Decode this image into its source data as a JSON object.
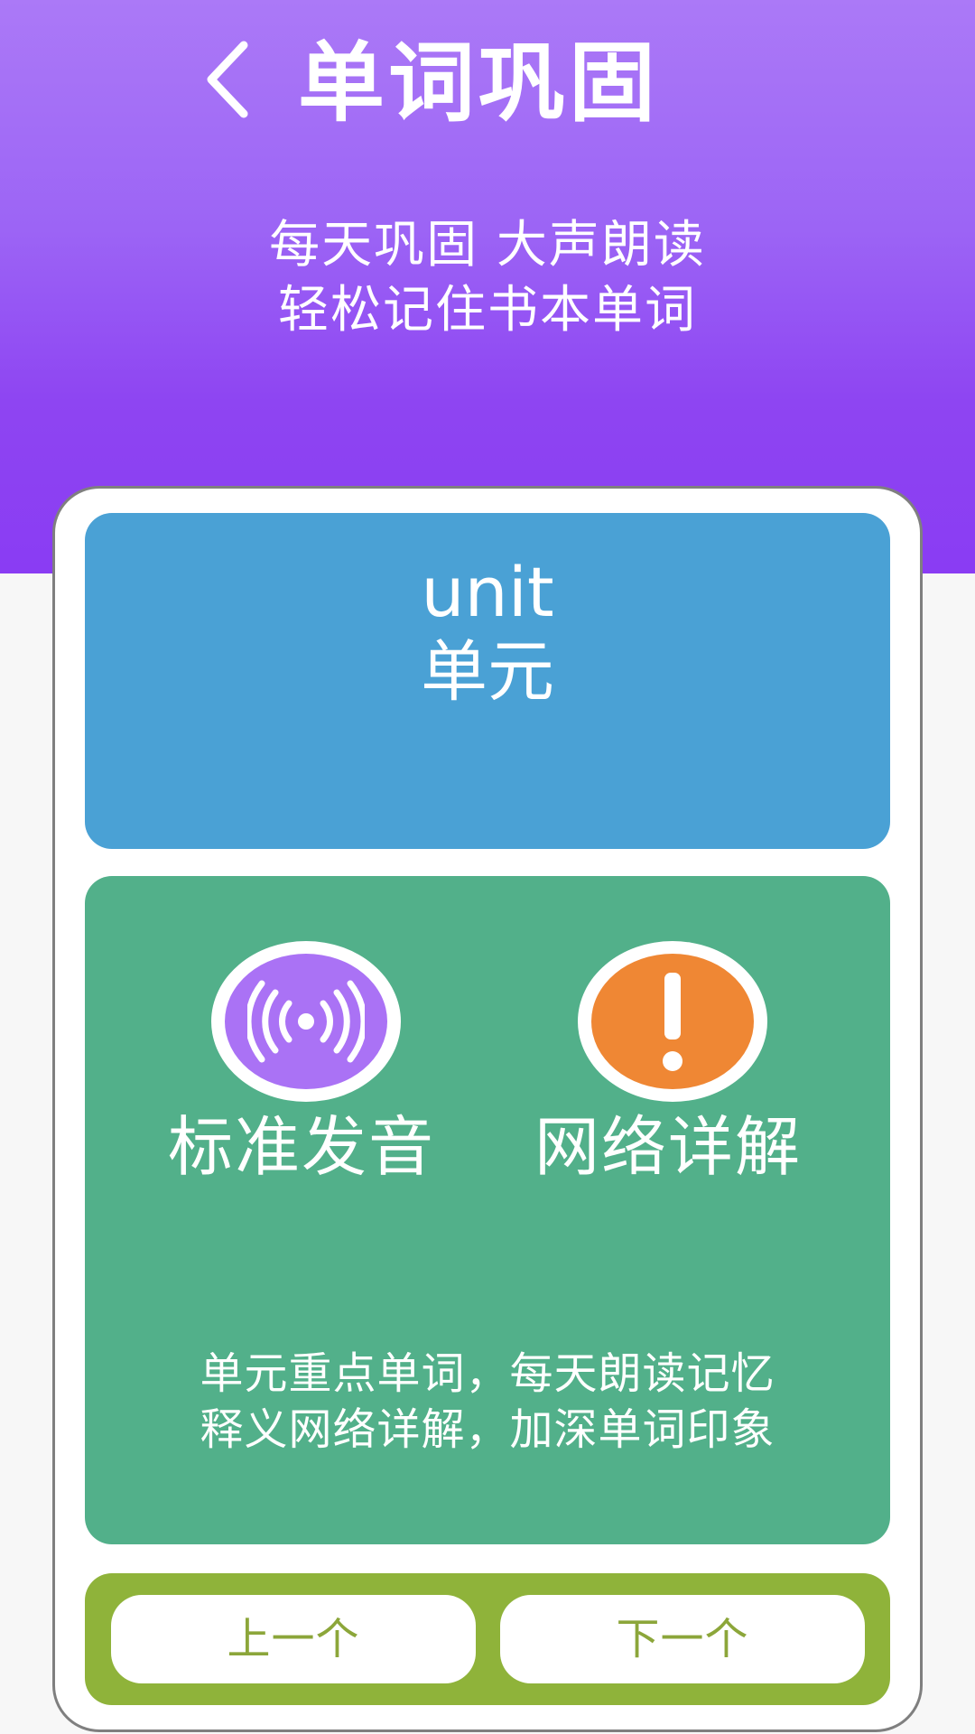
{
  "header": {
    "title": "单词巩固",
    "subtitle_line1": "每天巩固  大声朗读",
    "subtitle_line2": "轻松记住书本单词",
    "back_icon": "chevron-left-icon"
  },
  "word": {
    "term": "unit",
    "meaning": "单元"
  },
  "features": [
    {
      "label": "标准发音",
      "icon": "sound-wave-icon",
      "color": "#aa72f5"
    },
    {
      "label": "网络详解",
      "icon": "exclamation-icon",
      "color": "#ef8734"
    }
  ],
  "description": {
    "line1": "单元重点单词，每天朗读记忆",
    "line2": "释义网络详解，加深单词印象"
  },
  "navigation": {
    "prev_label": "上一个",
    "next_label": "下一个"
  },
  "colors": {
    "header_gradient_start": "#ab79f7",
    "header_gradient_end": "#8a3cf3",
    "word_panel": "#4aa1d5",
    "feature_panel": "#52b08a",
    "nav_panel": "#8fb33a",
    "nav_text": "#8ca63a"
  }
}
